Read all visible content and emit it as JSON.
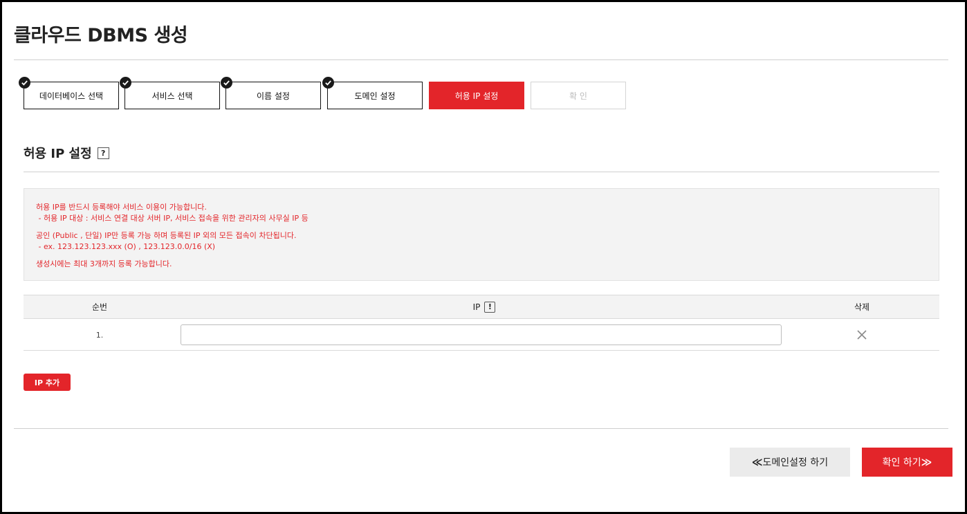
{
  "page": {
    "title": "클라우드 DBMS 생성"
  },
  "steps": [
    {
      "label": "데이터베이스 선택",
      "state": "done"
    },
    {
      "label": "서비스 선택",
      "state": "done"
    },
    {
      "label": "이름 설정",
      "state": "done"
    },
    {
      "label": "도메인 설정",
      "state": "done"
    },
    {
      "label": "허용 IP 설정",
      "state": "active"
    },
    {
      "label": "확 인",
      "state": "disabled"
    }
  ],
  "section": {
    "title": "허용 IP 설정",
    "help_icon": "?"
  },
  "notice": {
    "line1": "허용 IP를 반드시 등록해야 서비스 이용이 가능합니다.",
    "line2": " - 허용 IP 대상 : 서비스 연결 대상 서버 IP, 서비스 접속을 위한 관리자의 사무실 IP 등",
    "line3": "공인 (Public , 단일) IP만 등록 가능 하며 등록된 IP 외의 모든 접속이 차단됩니다.",
    "line4": " - ex. 123.123.123.xxx (O) , 123.123.0.0/16 (X)",
    "line5": "생성시에는 최대 3개까지 등록 가능합니다."
  },
  "table": {
    "headers": {
      "no": "순번",
      "ip": "IP",
      "ip_info_icon": "!",
      "delete": "삭제"
    },
    "rows": [
      {
        "no": "1.",
        "ip_value": "",
        "ip_placeholder": ""
      }
    ]
  },
  "buttons": {
    "add_ip": "IP 추가",
    "prev_chevron": "≪",
    "prev": "도메인설정 하기",
    "next": "확인 하기",
    "next_chevron": "≫"
  },
  "colors": {
    "accent": "#e3252a",
    "done_check": "#1a1a1a",
    "notice_bg": "#f3f3f3"
  },
  "icons": {
    "step_done": "check-icon",
    "help": "question-icon",
    "ip_info": "exclamation-icon",
    "delete": "close-icon"
  }
}
